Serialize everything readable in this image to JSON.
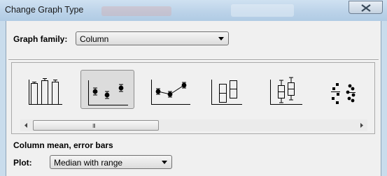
{
  "window": {
    "title": "Change Graph Type"
  },
  "graph_family": {
    "label": "Graph family:",
    "value": "Column"
  },
  "gallery": {
    "items": [
      {
        "name": "column-bars-icon",
        "selected": false
      },
      {
        "name": "column-mean-error-bars-icon",
        "selected": true
      },
      {
        "name": "column-connected-means-icon",
        "selected": false
      },
      {
        "name": "column-floating-bars-icon",
        "selected": false
      },
      {
        "name": "column-box-whiskers-icon",
        "selected": false
      },
      {
        "name": "column-scatter-dots-icon",
        "selected": false
      }
    ],
    "scroll_grip": "III"
  },
  "description": "Column mean, error bars",
  "plot": {
    "label": "Plot:",
    "value": "Median with range"
  }
}
